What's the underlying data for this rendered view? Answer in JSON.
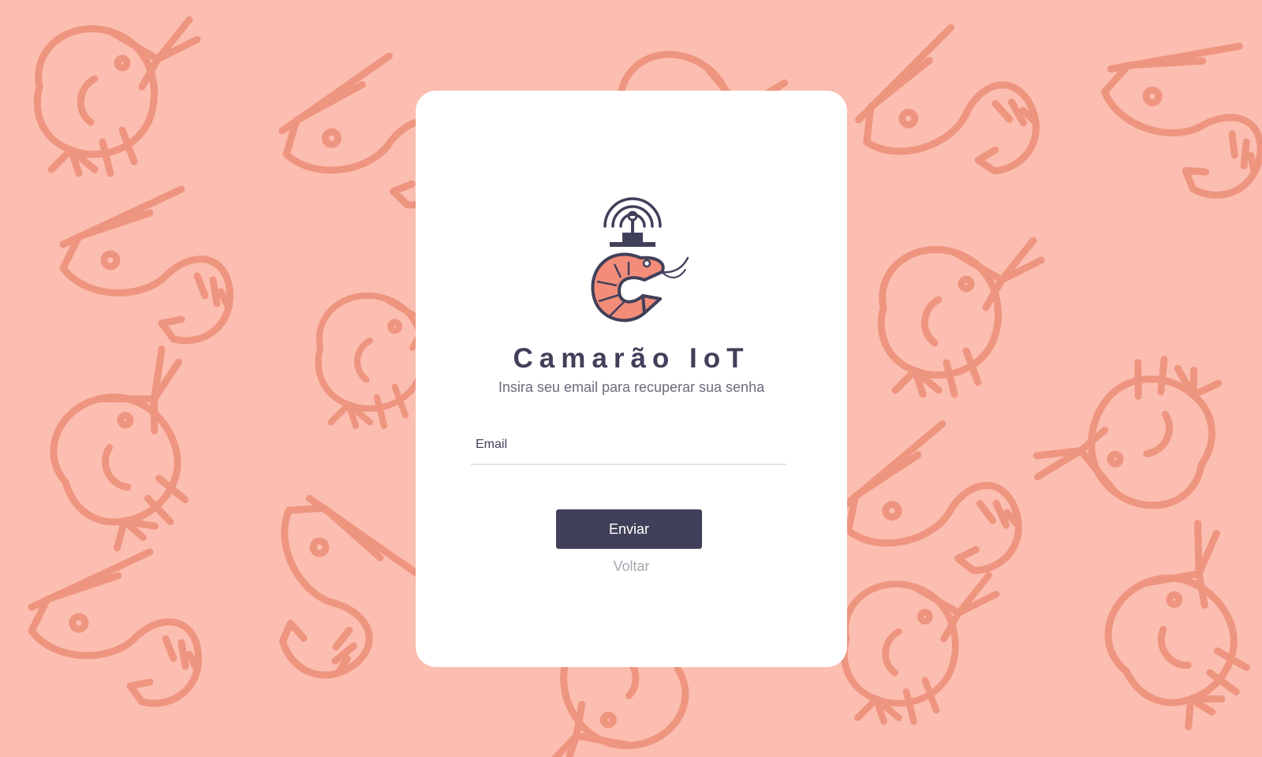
{
  "app": {
    "title": "Camarão IoT",
    "subtitle": "Insira seu email para recuperar sua senha"
  },
  "form": {
    "email_placeholder": "Email",
    "email_value": "",
    "submit_label": "Enviar",
    "back_label": "Voltar"
  },
  "colors": {
    "background": "#fcbeb0",
    "pattern": "#ee9580",
    "card": "#ffffff",
    "primary": "#41405a",
    "logo_accent": "#f38d7a",
    "link_muted": "#a8a8b2"
  },
  "icons": {
    "logo": "shrimp-antenna-icon",
    "background": "shrimp-pattern"
  }
}
